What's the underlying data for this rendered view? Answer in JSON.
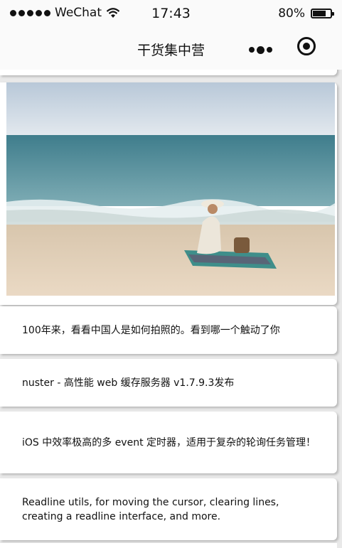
{
  "status_bar": {
    "carrier": "WeChat",
    "time": "17:43",
    "battery_percent": "80%",
    "battery_level": 0.8
  },
  "nav": {
    "title": "干货集中营",
    "menu_icon": "more-dots-icon",
    "close_icon": "close-target-icon"
  },
  "feed": {
    "image_alt": "beach photo",
    "articles": [
      {
        "title": "100年来，看看中国人是如何拍照的。看到哪一个触动了你"
      },
      {
        "title": "nuster - 高性能 web 缓存服务器 v1.7.9.3发布"
      },
      {
        "title": "iOS 中效率极高的多 event 定时器，适用于复杂的轮询任务管理！"
      },
      {
        "title": "Readline utils, for moving the cursor, clearing lines, creating a readline interface, and more."
      }
    ]
  }
}
